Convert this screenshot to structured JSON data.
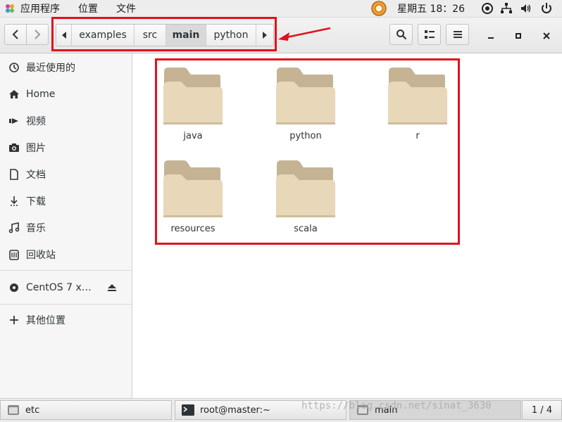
{
  "topbar": {
    "applications": "应用程序",
    "places": "位置",
    "files": "文件",
    "clock": "星期五 18：26"
  },
  "pathbar": {
    "crumbs": [
      "examples",
      "src",
      "main",
      "python"
    ],
    "active": "main"
  },
  "sidebar": {
    "items": [
      {
        "label": "最近使用的",
        "icon": "recent-icon"
      },
      {
        "label": "Home",
        "icon": "home-icon"
      },
      {
        "label": "视频",
        "icon": "video-icon"
      },
      {
        "label": "图片",
        "icon": "camera-icon"
      },
      {
        "label": "文档",
        "icon": "document-icon"
      },
      {
        "label": "下载",
        "icon": "download-icon"
      },
      {
        "label": "音乐",
        "icon": "music-icon"
      },
      {
        "label": "回收站",
        "icon": "trash-icon"
      }
    ],
    "device": {
      "label": "CentOS 7 x…",
      "icon": "disc-icon"
    },
    "other": {
      "label": "其他位置",
      "icon": "plus-icon"
    }
  },
  "folders": [
    "java",
    "python",
    "r",
    "resources",
    "scala"
  ],
  "taskbar": {
    "items": [
      "etc",
      "root@master:~",
      "main"
    ],
    "pager": "1 / 4"
  },
  "watermark": "https://blog.csdn.net/sinat_3630",
  "colors": {
    "annotation": "#e0121c",
    "folder": "#e8d7b9",
    "folder_tab": "#c5b394"
  }
}
